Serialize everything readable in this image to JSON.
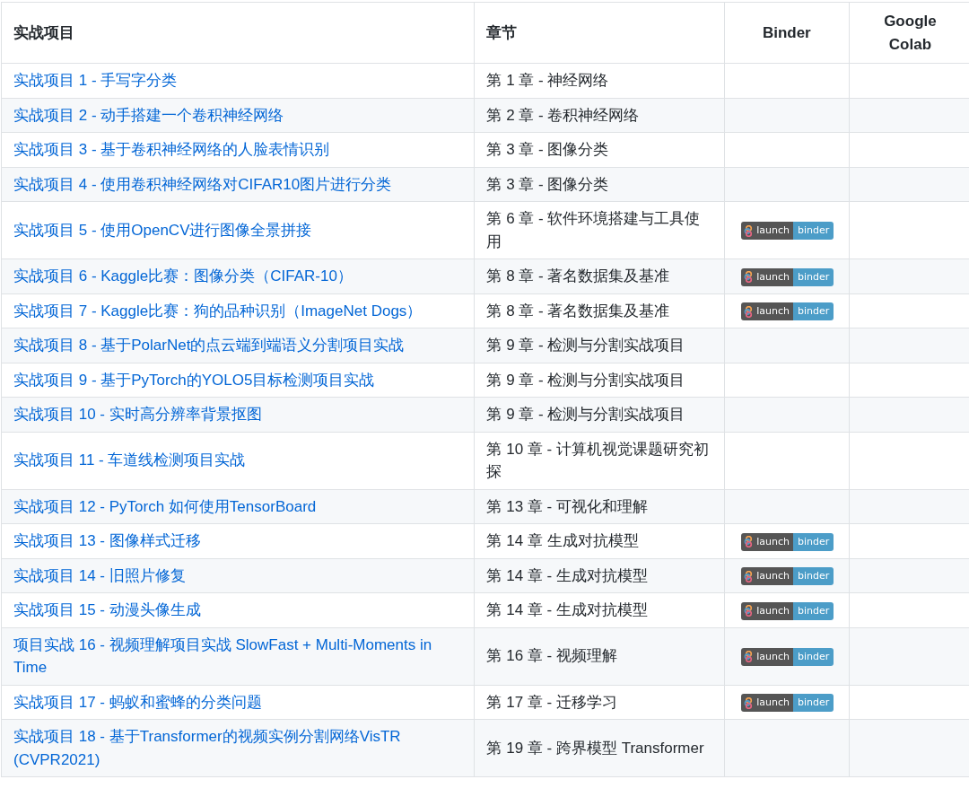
{
  "table": {
    "columns": [
      "实战项目",
      "章节",
      "Binder",
      "Google Colab"
    ],
    "rows": [
      {
        "project": "实战项目 1 - 手写字分类",
        "chapter": "第 1 章 - 神经网络"
      },
      {
        "project": "实战项目 2 - 动手搭建一个卷积神经网络",
        "chapter": "第 2 章 - 卷积神经网络"
      },
      {
        "project": "实战项目 3 - 基于卷积神经网络的人脸表情识别",
        "chapter": "第 3 章 - 图像分类"
      },
      {
        "project": "实战项目 4 - 使用卷积神经网络对CIFAR10图片进行分类",
        "chapter": "第 3 章 - 图像分类"
      },
      {
        "project": "实战项目 5 - 使用OpenCV进行图像全景拼接",
        "chapter": "第 6 章 - 软件环境搭建与工具使用",
        "binder": {
          "left": "launch",
          "right": "binder"
        }
      },
      {
        "project": "实战项目 6 - Kaggle比赛：图像分类（CIFAR-10）",
        "chapter": "第 8 章 - 著名数据集及基准",
        "binder": {
          "left": "launch",
          "right": "binder"
        }
      },
      {
        "project": "实战项目 7 - Kaggle比赛：狗的品种识别（ImageNet Dogs）",
        "chapter": "第 8 章 - 著名数据集及基准",
        "binder": {
          "left": "launch",
          "right": "binder"
        }
      },
      {
        "project": "实战项目 8 - 基于PolarNet的点云端到端语义分割项目实战",
        "chapter": "第 9 章 - 检测与分割实战项目"
      },
      {
        "project": "实战项目 9 - 基于PyTorch的YOLO5目标检测项目实战",
        "chapter": "第 9 章 - 检测与分割实战项目"
      },
      {
        "project": "实战项目 10 - 实时高分辨率背景抠图",
        "chapter": "第 9 章 - 检测与分割实战项目"
      },
      {
        "project": "实战项目 11 - 车道线检测项目实战",
        "chapter": "第 10 章 - 计算机视觉课题研究初探"
      },
      {
        "project": "实战项目 12 - PyTorch 如何使用TensorBoard",
        "chapter": "第 13 章 - 可视化和理解"
      },
      {
        "project": "实战项目 13 - 图像样式迁移",
        "chapter": "第 14 章 生成对抗模型",
        "binder": {
          "left": "launch",
          "right": "binder"
        }
      },
      {
        "project": "实战项目 14 - 旧照片修复",
        "chapter": "第 14 章 - 生成对抗模型",
        "binder": {
          "left": "launch",
          "right": "binder"
        }
      },
      {
        "project": "实战项目 15 - 动漫头像生成",
        "chapter": "第 14 章 - 生成对抗模型",
        "binder": {
          "left": "launch",
          "right": "binder"
        }
      },
      {
        "project": "项目实战 16 - 视频理解项目实战 SlowFast + Multi-Moments in Time",
        "chapter": "第 16 章 - 视频理解",
        "binder": {
          "left": "launch",
          "right": "binder"
        }
      },
      {
        "project": "实战项目 17 - 蚂蚁和蜜蜂的分类问题",
        "chapter": "第 17 章 - 迁移学习",
        "binder": {
          "left": "launch",
          "right": "binder"
        }
      },
      {
        "project": "实战项目 18 - 基于Transformer的视频实例分割网络VisTR (CVPR2021)",
        "chapter": "第 19 章 - 跨界模型 Transformer"
      }
    ]
  }
}
